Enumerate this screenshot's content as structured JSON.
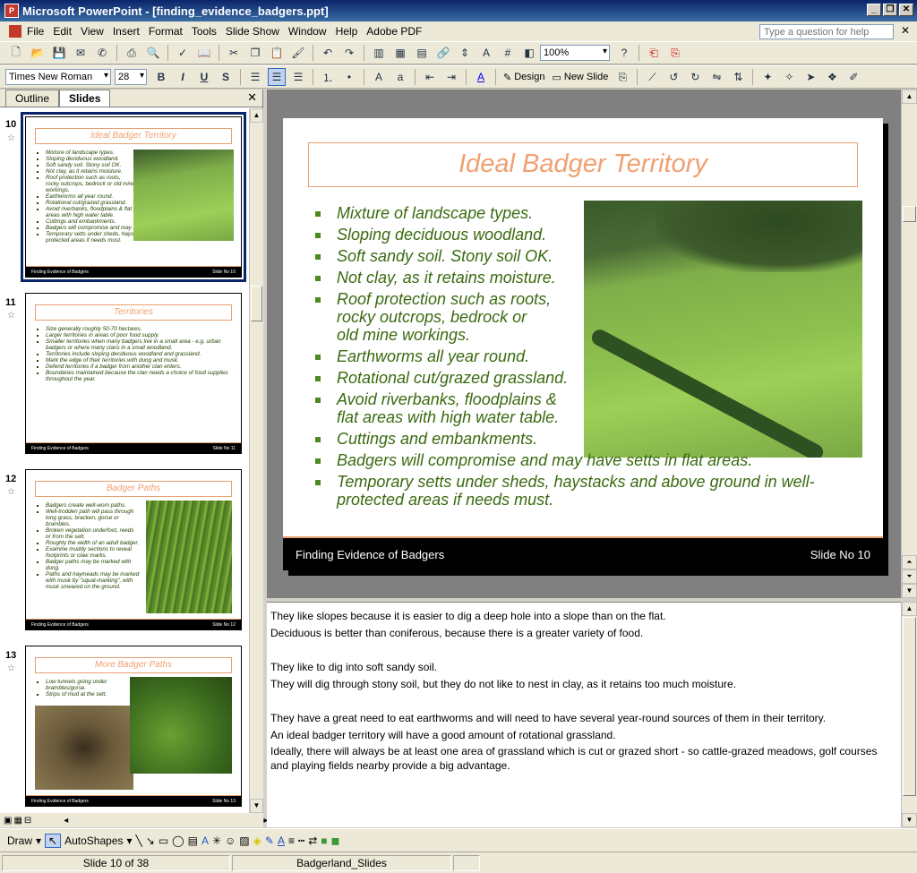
{
  "window": {
    "title": "Microsoft PowerPoint - [finding_evidence_badgers.ppt]",
    "app_icon": "P"
  },
  "menu": {
    "items": [
      "File",
      "Edit",
      "View",
      "Insert",
      "Format",
      "Tools",
      "Slide Show",
      "Window",
      "Help",
      "Adobe PDF"
    ],
    "help_placeholder": "Type a question for help"
  },
  "toolbar": {
    "zoom": "100%",
    "font_name": "Times New Roman",
    "font_size": "28",
    "bold": "B",
    "italic": "I",
    "underline": "U",
    "strike": "S",
    "design_label": "Design",
    "new_slide_label": "New Slide"
  },
  "left_pane": {
    "tabs": [
      "Outline",
      "Slides"
    ],
    "thumbnails": [
      {
        "number": "10",
        "title": "Ideal Badger Territory",
        "bullets": [
          "Mixture of landscape types.",
          "Sloping deciduous woodland.",
          "Soft sandy soil. Stony soil OK.",
          "Not clay, as it retains moisture.",
          "Roof protection such as roots, rocky outcrops, bedrock or old mine workings.",
          "Earthworms all year round.",
          "Rotational cut/grazed grassland.",
          "Avoid riverbanks, floodplains & flat areas with high water table.",
          "Cuttings and embankments.",
          "Badgers will compromise and may have setts in flat areas.",
          "Temporary setts under sheds, haystacks and above ground in well-protected areas if needs must."
        ],
        "footer_left": "Finding Evidence of Badgers",
        "footer_right": "Slide No 10"
      },
      {
        "number": "11",
        "title": "Territories",
        "bullets": [
          "Size generally roughly 50-70 hectares.",
          "Larger territories in areas of poor food supply.",
          "Smaller territories when many badgers live in a small area - e.g. urban badgers or where many clans in a small woodland.",
          "Territories include sloping deciduous woodland and grassland.",
          "Mark the edge of their territories with dung and musk.",
          "Defend territories if a badger from another clan enters.",
          "Boundaries maintained because the clan needs a choice of food supplies throughout the year."
        ],
        "footer_left": "Finding Evidence of Badgers",
        "footer_right": "Slide No 11"
      },
      {
        "number": "12",
        "title": "Badger Paths",
        "bullets": [
          "Badgers create well-worn paths.",
          "Well-trodden path will pass through long grass, bracken, gorse or brambles.",
          "Broken vegetation underfoot, reeds or from the sett.",
          "Roughly the width of an adult badger.",
          "Examine muddy sections to reveal footprints or claw marks.",
          "Badger paths may be marked with dung.",
          "Paths and haymeads may be marked with musk by \"squat-marking\", with musk smeared on the ground."
        ],
        "footer_left": "Finding Evidence of Badgers",
        "footer_right": "Slide No 12"
      },
      {
        "number": "13",
        "title": "More Badger Paths",
        "bullets": [
          "Low tunnels going under brambles/gorse.",
          "Strips of mud at the sett."
        ],
        "footer_left": "Finding Evidence of Badgers",
        "footer_right": "Slide No 13"
      }
    ]
  },
  "slide": {
    "title": "Ideal Badger Territory",
    "bullets": [
      "Mixture of landscape types.",
      "Sloping deciduous woodland.",
      "Soft sandy soil. Stony soil OK.",
      "Not clay, as it retains moisture.",
      "Roof protection such as roots,\nrocky outcrops, bedrock or\nold mine workings.",
      "Earthworms all year round.",
      "Rotational cut/grazed grassland.",
      "Avoid riverbanks, floodplains &\nflat areas with high water table.",
      "Cuttings and embankments.",
      "Badgers will compromise and may have setts in flat areas.",
      "Temporary setts under sheds, haystacks and above ground in well-\nprotected areas if needs must."
    ],
    "footer_left": "Finding Evidence of Badgers",
    "footer_right": "Slide No 10"
  },
  "notes": [
    "They like slopes because it is easier to dig a deep hole into a slope than on the flat.",
    "Deciduous is better than coniferous, because there is a greater variety of food.",
    "",
    "They like to dig into soft sandy soil.",
    "They will dig through stony soil, but they do not like to nest in clay, as it retains too much moisture.",
    "",
    "They have a great need to eat earthworms and will need to have several year-round sources of them in their territory.",
    "An ideal badger territory will have a good amount of rotational grassland.",
    "Ideally, there will always be at least one area of grassland which is cut or grazed short - so cattle-grazed meadows, golf courses and playing fields nearby provide a big advantage."
  ],
  "drawing": {
    "draw_label": "Draw",
    "autoshapes_label": "AutoShapes"
  },
  "status": {
    "slide_position": "Slide 10 of 38",
    "design_template": "Badgerland_Slides"
  },
  "colors": {
    "title_orange": "#f0a070",
    "bullet_green": "#3a6a10",
    "selection_navy": "#0a246a"
  }
}
